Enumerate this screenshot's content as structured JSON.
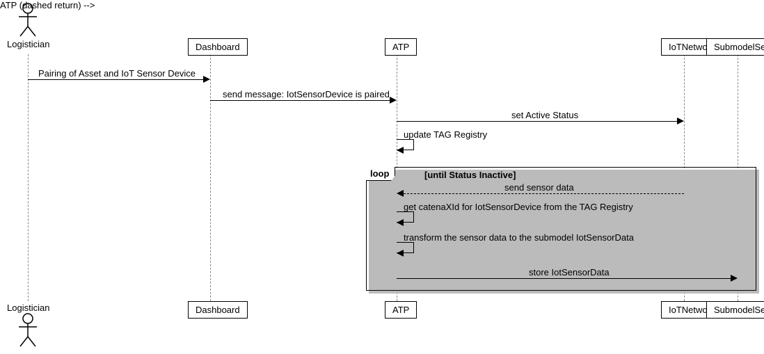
{
  "participants": {
    "actor": "Logistician",
    "dashboard": "Dashboard",
    "atp": "ATP",
    "iotnetwork": "IoTNetwork",
    "submodelserver": "SubmodelServer"
  },
  "messages": {
    "m1": "Pairing of Asset and IoT Sensor Device",
    "m2": "send message: IotSensorDevice is paired",
    "m3": "set Active Status",
    "m4": "update TAG Registry",
    "m5": "send sensor data",
    "m6": "get catenaXId for IotSensorDevice from the TAG Registry",
    "m7": "transform the sensor data to the submodel IotSensorData",
    "m8": "store IotSensorData"
  },
  "loop": {
    "label": "loop",
    "guard": "[until Status Inactive]"
  }
}
